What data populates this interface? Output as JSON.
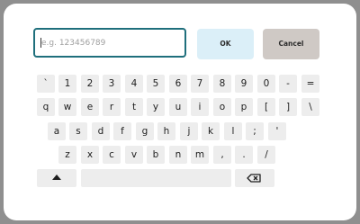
{
  "dialog": {
    "input": {
      "value": "",
      "placeholder": "e.g. 123456789"
    },
    "ok_label": "OK",
    "cancel_label": "Cancel"
  },
  "keyboard": {
    "row1": [
      "`",
      "1",
      "2",
      "3",
      "4",
      "5",
      "6",
      "7",
      "8",
      "9",
      "0",
      "-",
      "="
    ],
    "row2": [
      "q",
      "w",
      "e",
      "r",
      "t",
      "y",
      "u",
      "i",
      "o",
      "p",
      "[",
      "]",
      "\\"
    ],
    "row3": [
      "a",
      "s",
      "d",
      "f",
      "g",
      "h",
      "j",
      "k",
      "l",
      ";",
      "'"
    ],
    "row4": [
      "z",
      "x",
      "c",
      "v",
      "b",
      "n",
      "m",
      ",",
      ".",
      "/"
    ],
    "shift_icon": "shift-up-triangle-icon",
    "space_label": "",
    "backspace_icon": "backspace-icon"
  }
}
